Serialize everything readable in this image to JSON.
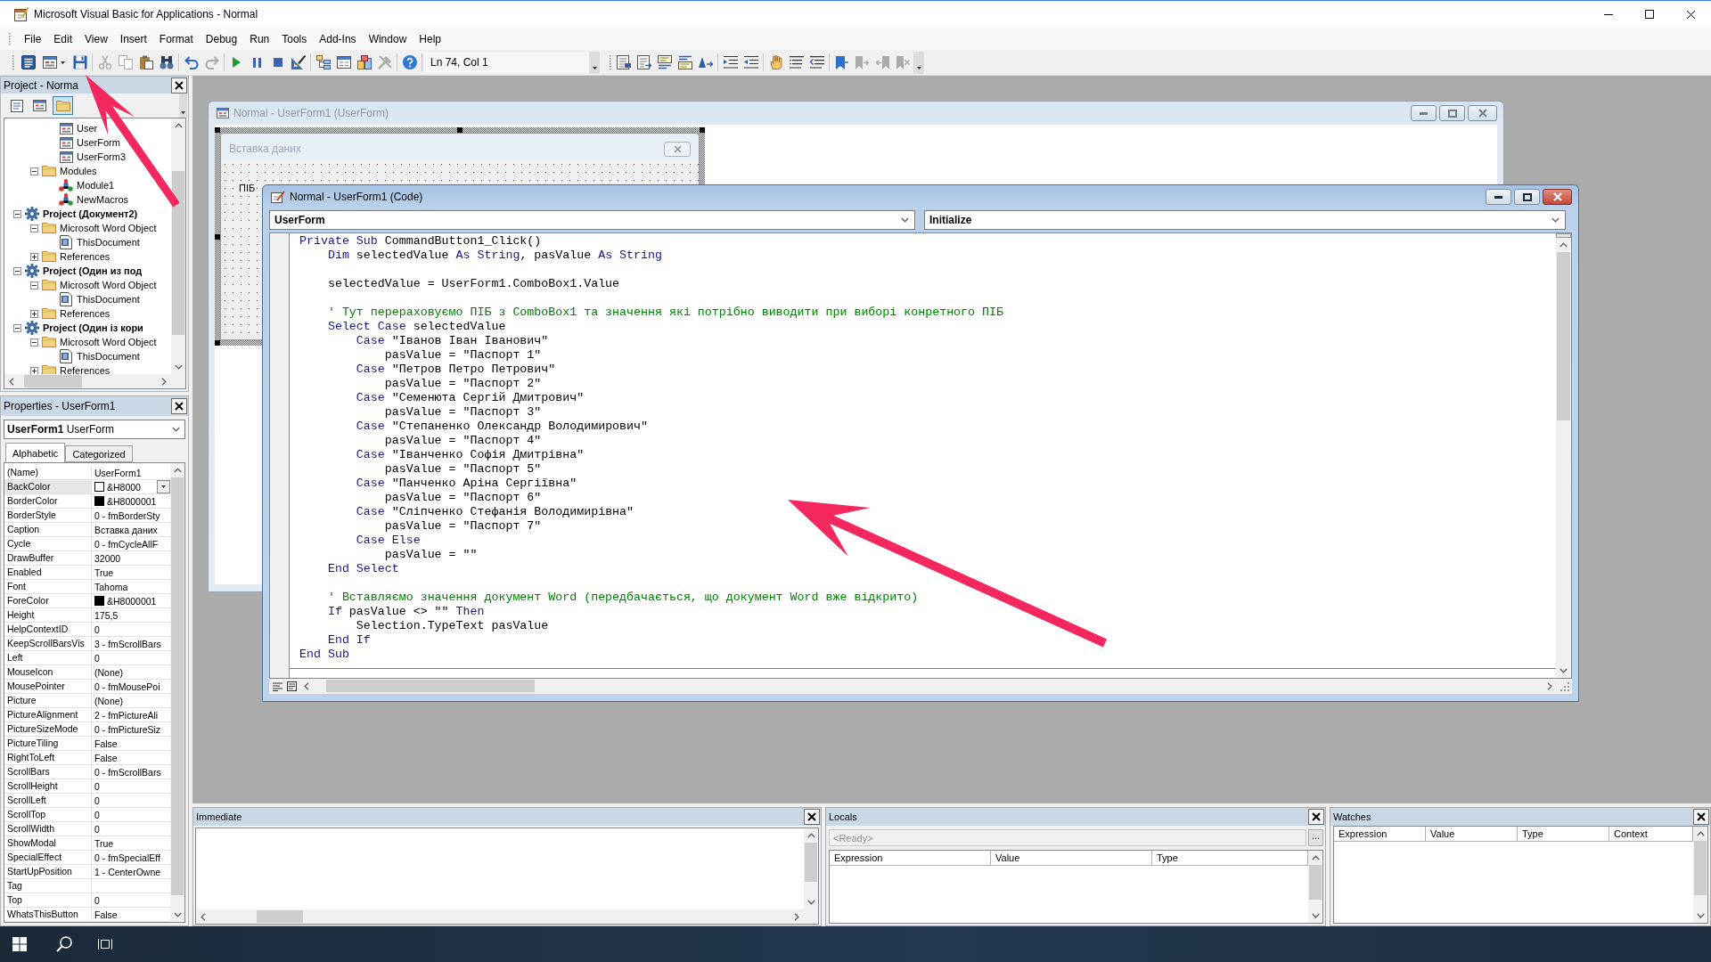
{
  "window": {
    "title": "Microsoft Visual Basic for Applications - Normal"
  },
  "menu": [
    "File",
    "Edit",
    "View",
    "Insert",
    "Format",
    "Debug",
    "Run",
    "Tools",
    "Add-Ins",
    "Window",
    "Help"
  ],
  "toolbars": [
    {
      "buttons": [
        {
          "kind": "word",
          "disabled": false
        },
        {
          "kind": "insert-form",
          "disabled": false
        },
        {
          "kind": "save",
          "disabled": false
        },
        {
          "kind": "separator"
        },
        {
          "kind": "cut",
          "disabled": true
        },
        {
          "kind": "copy",
          "disabled": true
        },
        {
          "kind": "paste",
          "disabled": false
        },
        {
          "kind": "find",
          "disabled": false
        },
        {
          "kind": "separator"
        },
        {
          "kind": "undo",
          "disabled": false
        },
        {
          "kind": "redo",
          "disabled": true
        },
        {
          "kind": "separator"
        },
        {
          "kind": "run",
          "disabled": false
        },
        {
          "kind": "break",
          "disabled": false
        },
        {
          "kind": "reset",
          "disabled": false
        },
        {
          "kind": "design",
          "disabled": false
        },
        {
          "kind": "separator"
        },
        {
          "kind": "explorer",
          "disabled": false
        },
        {
          "kind": "properties",
          "disabled": false
        },
        {
          "kind": "browser",
          "disabled": false
        },
        {
          "kind": "toolbox",
          "disabled": true
        },
        {
          "kind": "separator"
        },
        {
          "kind": "help",
          "disabled": false
        },
        {
          "kind": "separator"
        }
      ],
      "cursor_position": "Ln 74, Col 1"
    },
    {
      "buttons": [
        {
          "kind": "list-members",
          "disabled": false
        },
        {
          "kind": "list-constants",
          "disabled": false
        },
        {
          "kind": "quick-info",
          "disabled": false
        },
        {
          "kind": "param-info",
          "disabled": false
        },
        {
          "kind": "complete-word",
          "disabled": false
        },
        {
          "kind": "separator"
        },
        {
          "kind": "indent",
          "disabled": false
        },
        {
          "kind": "outdent",
          "disabled": false
        },
        {
          "kind": "separator"
        },
        {
          "kind": "breakpoint",
          "disabled": false
        },
        {
          "kind": "comment",
          "disabled": false
        },
        {
          "kind": "uncomment",
          "disabled": false
        },
        {
          "kind": "separator"
        },
        {
          "kind": "bookmark",
          "disabled": false
        },
        {
          "kind": "next-bookmark",
          "disabled": true
        },
        {
          "kind": "prev-bookmark",
          "disabled": true
        },
        {
          "kind": "clear-bookmarks",
          "disabled": true
        }
      ]
    }
  ],
  "project_pane": {
    "title": "Project - Norma",
    "tool_buttons": [
      {
        "kind": "view-code",
        "on": false
      },
      {
        "kind": "view-object",
        "on": false
      },
      {
        "kind": "toggle-folders",
        "on": true
      }
    ],
    "tree": [
      {
        "children": [
          {
            "children": [
              {
                "label": "User",
                "kind": "form"
              },
              {
                "label": "UserForm",
                "kind": "form"
              },
              {
                "label": "UserForm3",
                "kind": "form"
              }
            ]
          },
          {
            "label": "Modules",
            "kind": "folder",
            "expanded": true,
            "children": [
              {
                "label": "Module1",
                "kind": "module"
              },
              {
                "label": "NewMacros",
                "kind": "module"
              }
            ]
          }
        ]
      },
      {
        "label": "Project (Документ2)",
        "kind": "project",
        "expanded": true,
        "children": [
          {
            "label": "Microsoft Word Object",
            "kind": "folder",
            "expanded": true,
            "children": [
              {
                "label": "ThisDocument",
                "kind": "document"
              }
            ]
          },
          {
            "label": "References",
            "kind": "folder",
            "expanded": false
          }
        ]
      },
      {
        "label": "Project (Один из под",
        "kind": "project",
        "expanded": true,
        "children": [
          {
            "label": "Microsoft Word Object",
            "kind": "folder",
            "expanded": true,
            "children": [
              {
                "label": "ThisDocument",
                "kind": "document"
              }
            ]
          },
          {
            "label": "References",
            "kind": "folder",
            "expanded": false
          }
        ]
      },
      {
        "label": "Project (Один із кори",
        "kind": "project",
        "expanded": true,
        "children": [
          {
            "label": "Microsoft Word Object",
            "kind": "folder",
            "expanded": true,
            "children": [
              {
                "label": "ThisDocument",
                "kind": "document"
              }
            ]
          },
          {
            "label": "References",
            "kind": "folder",
            "expanded": false
          }
        ]
      }
    ]
  },
  "properties_pane": {
    "title": "Properties - UserForm1",
    "object": {
      "name": "UserForm1",
      "type": "UserForm"
    },
    "tabs": [
      {
        "label": "Alphabetic",
        "selected": true
      },
      {
        "label": "Categorized",
        "selected": false
      }
    ],
    "rows": [
      {
        "name": "(Name)",
        "value": "UserForm1",
        "selected": false
      },
      {
        "name": "BackColor",
        "value": "&H8000",
        "color": "#ffffff",
        "selected": true
      },
      {
        "name": "BorderColor",
        "value": "&H8000001",
        "color": "#000000",
        "selected": false
      },
      {
        "name": "BorderStyle",
        "value": "0 - fmBorderSty",
        "selected": false
      },
      {
        "name": "Caption",
        "value": "Вставка даних",
        "selected": false
      },
      {
        "name": "Cycle",
        "value": "0 - fmCycleAllF",
        "selected": false
      },
      {
        "name": "DrawBuffer",
        "value": "32000",
        "selected": false
      },
      {
        "name": "Enabled",
        "value": "True",
        "selected": false
      },
      {
        "name": "Font",
        "value": "Tahoma",
        "selected": false
      },
      {
        "name": "ForeColor",
        "value": "&H8000001",
        "color": "#000000",
        "selected": false
      },
      {
        "name": "Height",
        "value": "175,5",
        "selected": false
      },
      {
        "name": "HelpContextID",
        "value": "0",
        "selected": false
      },
      {
        "name": "KeepScrollBarsVis",
        "value": "3 - fmScrollBars",
        "selected": false
      },
      {
        "name": "Left",
        "value": "0",
        "selected": false
      },
      {
        "name": "MouseIcon",
        "value": "(None)",
        "selected": false
      },
      {
        "name": "MousePointer",
        "value": "0 - fmMousePoi",
        "selected": false
      },
      {
        "name": "Picture",
        "value": "(None)",
        "selected": false
      },
      {
        "name": "PictureAlignment",
        "value": "2 - fmPictureAli",
        "selected": false
      },
      {
        "name": "PictureSizeMode",
        "value": "0 - fmPictureSiz",
        "selected": false
      },
      {
        "name": "PictureTiling",
        "value": "False",
        "selected": false
      },
      {
        "name": "RightToLeft",
        "value": "False",
        "selected": false
      },
      {
        "name": "ScrollBars",
        "value": "0 - fmScrollBars",
        "selected": false
      },
      {
        "name": "ScrollHeight",
        "value": "0",
        "selected": false
      },
      {
        "name": "ScrollLeft",
        "value": "0",
        "selected": false
      },
      {
        "name": "ScrollTop",
        "value": "0",
        "selected": false
      },
      {
        "name": "ScrollWidth",
        "value": "0",
        "selected": false
      },
      {
        "name": "ShowModal",
        "value": "True",
        "selected": false
      },
      {
        "name": "SpecialEffect",
        "value": "0 - fmSpecialEff",
        "selected": false
      },
      {
        "name": "StartUpPosition",
        "value": "1 - CenterOwne",
        "selected": false
      },
      {
        "name": "Tag",
        "selected": false
      },
      {
        "name": "Top",
        "value": "0",
        "selected": false
      },
      {
        "name": "WhatsThisButton",
        "value": "False",
        "selected": false
      }
    ]
  },
  "designer_window": {
    "title": "Normal - UserForm1 (UserForm)",
    "active": false,
    "form_caption": "Вставка даних",
    "labels": [
      "ПІБ"
    ]
  },
  "code_window": {
    "title": "Normal - UserForm1 (Code)",
    "active": true,
    "object": "UserForm",
    "procedure": "Initialize",
    "lines": [
      {
        "kind": "code",
        "tokens": [
          {
            "kind": "keyword",
            "text": "Private Sub"
          },
          {
            "kind": "text",
            "text": " CommandButton1_Click()"
          }
        ]
      },
      {
        "kind": "code",
        "tokens": [
          {
            "kind": "keyword",
            "text": "    Dim"
          },
          {
            "kind": "text",
            "text": " selectedValue "
          },
          {
            "kind": "keyword",
            "text": "As String"
          },
          {
            "kind": "text",
            "text": ", pasValue "
          },
          {
            "kind": "keyword",
            "text": "As String"
          }
        ]
      },
      {
        "kind": "blank"
      },
      {
        "kind": "code",
        "tokens": [
          {
            "kind": "text",
            "text": "    selectedValue = UserForm1.ComboBox1.Value"
          }
        ]
      },
      {
        "kind": "blank"
      },
      {
        "kind": "code",
        "tokens": [
          {
            "kind": "comment",
            "text": "    ' Тут перераховуємо ПІБ з ComboBox1 та значення які потрібно виводити при виборі конретного ПІБ"
          }
        ]
      },
      {
        "kind": "code",
        "tokens": [
          {
            "kind": "keyword",
            "text": "    Select Case"
          },
          {
            "kind": "text",
            "text": " selectedValue"
          }
        ]
      },
      {
        "kind": "code",
        "tokens": [
          {
            "kind": "keyword",
            "text": "        Case"
          },
          {
            "kind": "text",
            "text": " \"Іванов Іван Іванович\""
          }
        ]
      },
      {
        "kind": "code",
        "tokens": [
          {
            "kind": "text",
            "text": "            pasValue = \"Паспорт 1\""
          }
        ]
      },
      {
        "kind": "code",
        "tokens": [
          {
            "kind": "keyword",
            "text": "        Case"
          },
          {
            "kind": "text",
            "text": " \"Петров Петро Петрович\""
          }
        ]
      },
      {
        "kind": "code",
        "tokens": [
          {
            "kind": "text",
            "text": "            pasValue = \"Паспорт 2\""
          }
        ]
      },
      {
        "kind": "code",
        "tokens": [
          {
            "kind": "keyword",
            "text": "        Case"
          },
          {
            "kind": "text",
            "text": " \"Семенюта Сергій Дмитрович\""
          }
        ]
      },
      {
        "kind": "code",
        "tokens": [
          {
            "kind": "text",
            "text": "            pasValue = \"Паспорт 3\""
          }
        ]
      },
      {
        "kind": "code",
        "tokens": [
          {
            "kind": "keyword",
            "text": "        Case"
          },
          {
            "kind": "text",
            "text": " \"Степаненко Олександр Володимирович\""
          }
        ]
      },
      {
        "kind": "code",
        "tokens": [
          {
            "kind": "text",
            "text": "            pasValue = \"Паспорт 4\""
          }
        ]
      },
      {
        "kind": "code",
        "tokens": [
          {
            "kind": "keyword",
            "text": "        Case"
          },
          {
            "kind": "text",
            "text": " \"Іванченко Софія Дмитрівна\""
          }
        ]
      },
      {
        "kind": "code",
        "tokens": [
          {
            "kind": "text",
            "text": "            pasValue = \"Паспорт 5\""
          }
        ]
      },
      {
        "kind": "code",
        "tokens": [
          {
            "kind": "keyword",
            "text": "        Case"
          },
          {
            "kind": "text",
            "text": " \"Панченко Аріна Сергіївна\""
          }
        ]
      },
      {
        "kind": "code",
        "tokens": [
          {
            "kind": "text",
            "text": "            pasValue = \"Паспорт 6\""
          }
        ]
      },
      {
        "kind": "code",
        "tokens": [
          {
            "kind": "keyword",
            "text": "        Case"
          },
          {
            "kind": "text",
            "text": " \"Сліпченко Стефанія Володимирівна\""
          }
        ]
      },
      {
        "kind": "code",
        "tokens": [
          {
            "kind": "text",
            "text": "            pasValue = \"Паспорт 7\""
          }
        ]
      },
      {
        "kind": "code",
        "tokens": [
          {
            "kind": "keyword",
            "text": "        Case Else"
          }
        ]
      },
      {
        "kind": "code",
        "tokens": [
          {
            "kind": "text",
            "text": "            pasValue = \"\""
          }
        ]
      },
      {
        "kind": "code",
        "tokens": [
          {
            "kind": "keyword",
            "text": "    End Select"
          }
        ]
      },
      {
        "kind": "blank"
      },
      {
        "kind": "code",
        "tokens": [
          {
            "kind": "comment",
            "text": "    ' Вставляємо значення документ Word (передбачається, що документ Word вже відкрито)"
          }
        ]
      },
      {
        "kind": "code",
        "tokens": [
          {
            "kind": "keyword",
            "text": "    If"
          },
          {
            "kind": "text",
            "text": " pasValue <> \"\" "
          },
          {
            "kind": "keyword",
            "text": "Then"
          }
        ]
      },
      {
        "kind": "code",
        "tokens": [
          {
            "kind": "text",
            "text": "        Selection.TypeText pasValue"
          }
        ]
      },
      {
        "kind": "code",
        "tokens": [
          {
            "kind": "keyword",
            "text": "    End If"
          }
        ]
      },
      {
        "kind": "code",
        "tokens": [
          {
            "kind": "keyword",
            "text": "End Sub"
          }
        ]
      }
    ]
  },
  "immediate": {
    "title": "Immediate"
  },
  "locals": {
    "title": "Locals",
    "status": {
      "value": "<Ready>",
      "disabled": true
    },
    "button": "...",
    "columns": [
      "Expression",
      "Value",
      "Type"
    ]
  },
  "watches": {
    "title": "Watches",
    "columns": [
      "Expression",
      "Value",
      "Type",
      "Context"
    ]
  }
}
